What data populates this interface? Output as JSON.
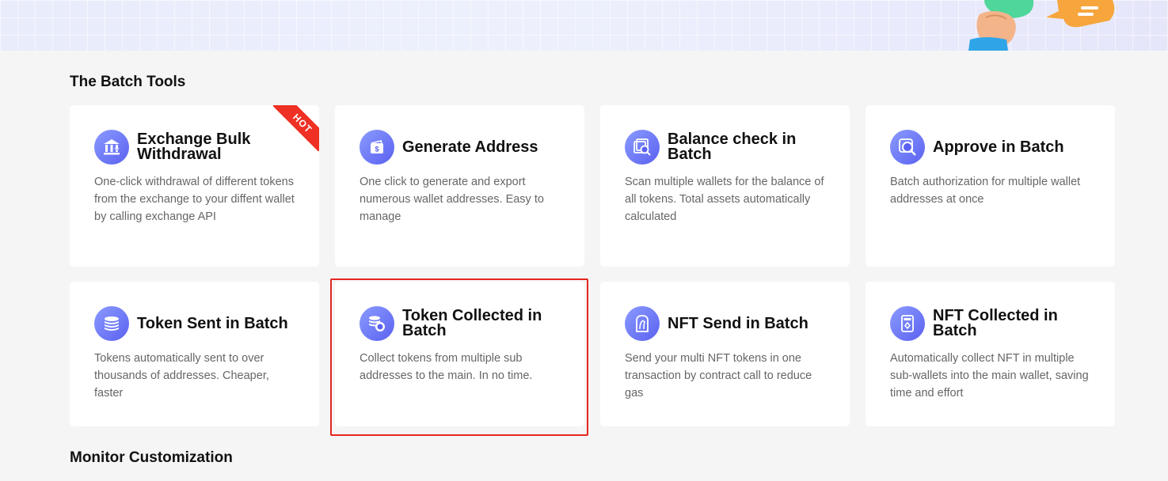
{
  "sections": {
    "batch_tools": "The Batch Tools",
    "monitor": "Monitor Customization"
  },
  "cards": [
    {
      "title": "Exchange Bulk Withdrawal",
      "desc": "One-click withdrawal of different tokens from the exchange to your diffent wallet by calling exchange API",
      "icon": "bank-withdraw-icon",
      "badge": "HOT"
    },
    {
      "title": "Generate Address",
      "desc": "One click to generate and export numerous wallet addresses. Easy to manage",
      "icon": "wallet-dollar-icon"
    },
    {
      "title": "Balance check in Batch",
      "desc": "Scan multiple wallets for the balance of all tokens. Total assets automatically calculated",
      "icon": "balance-search-icon"
    },
    {
      "title": "Approve in Batch",
      "desc": "Batch authorization for multiple wallet addresses at once",
      "icon": "approve-magnifier-icon"
    },
    {
      "title": "Token Sent in Batch",
      "desc": "Tokens automatically sent to over thousands of addresses. Cheaper, faster",
      "icon": "coin-stack-icon"
    },
    {
      "title": "Token Collected in Batch",
      "desc": "Collect tokens from multiple sub addresses to the main. In no time.",
      "icon": "coin-collect-icon"
    },
    {
      "title": "NFT Send in Batch",
      "desc": "Send your multi NFT tokens in one transaction by contract call to reduce gas",
      "icon": "nft-portrait-icon"
    },
    {
      "title": "NFT Collected in Batch",
      "desc": "Automatically collect NFT in multiple sub-wallets into the main wallet, saving time and effort",
      "icon": "nft-card-icon"
    }
  ],
  "colors": {
    "accent": "#5b61f0",
    "hot": "#ee3124",
    "highlight": "#e52620"
  }
}
